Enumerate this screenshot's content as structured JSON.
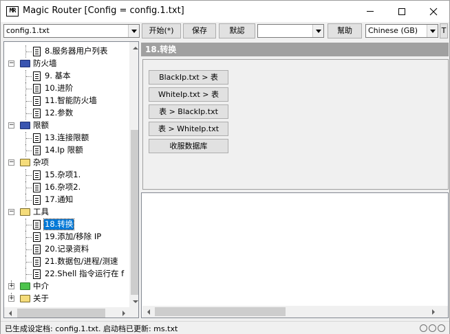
{
  "window": {
    "title": "Magic Router [Config = config.1.txt]",
    "app_icon": "MR"
  },
  "toolbar": {
    "config_value": "config.1.txt",
    "start_label": "开始(*)",
    "save_label": "保存",
    "default_label": "默認",
    "blank_value": "",
    "help_label": "幫助",
    "language_value": "Chinese (GB)",
    "extra_label": "T"
  },
  "tree": {
    "items": [
      {
        "label": "8.服务器用户列表",
        "kind": "leaf"
      },
      {
        "label": "防火墙",
        "kind": "group",
        "icon": "folder-blue-icon"
      },
      {
        "label": "9. 基本",
        "kind": "leaf"
      },
      {
        "label": "10.进阶",
        "kind": "leaf"
      },
      {
        "label": "11.智能防火墙",
        "kind": "leaf"
      },
      {
        "label": "12.参数",
        "kind": "leaf"
      },
      {
        "label": "限额",
        "kind": "group",
        "icon": "folder-blue-icon"
      },
      {
        "label": "13.连接限额",
        "kind": "leaf"
      },
      {
        "label": "14.Ip 限额",
        "kind": "leaf"
      },
      {
        "label": "杂项",
        "kind": "group",
        "icon": "folder-icon"
      },
      {
        "label": "15.杂项1.",
        "kind": "leaf"
      },
      {
        "label": "16.杂项2.",
        "kind": "leaf"
      },
      {
        "label": "17.通知",
        "kind": "leaf"
      },
      {
        "label": "工具",
        "kind": "group",
        "icon": "folder-icon"
      },
      {
        "label": "18.转换",
        "kind": "leaf",
        "selected": true
      },
      {
        "label": "19.添加/移除 IP",
        "kind": "leaf"
      },
      {
        "label": "20.记录资料",
        "kind": "leaf"
      },
      {
        "label": "21.数据包/进程/测速",
        "kind": "leaf"
      },
      {
        "label": "22.Shell 指令运行在 f",
        "kind": "leaf"
      },
      {
        "label": "中介",
        "kind": "group-collapsed",
        "icon": "folder-green-icon"
      },
      {
        "label": "关于",
        "kind": "group-collapsed",
        "icon": "folder-icon"
      }
    ]
  },
  "panel": {
    "header": "18.转换",
    "buttons": [
      "BlackIp.txt > 表",
      "WhiteIp.txt > 表",
      "表 > BlackIp.txt",
      "表 > WhiteIp.txt",
      "收服数据库"
    ]
  },
  "status": {
    "text": "已生成设定档: config.1.txt. 启动档已更新: ms.txt"
  },
  "colors": {
    "selection": "#0078d7",
    "header_bg": "#a0a0a0",
    "window_bg": "#f0f0f0"
  }
}
